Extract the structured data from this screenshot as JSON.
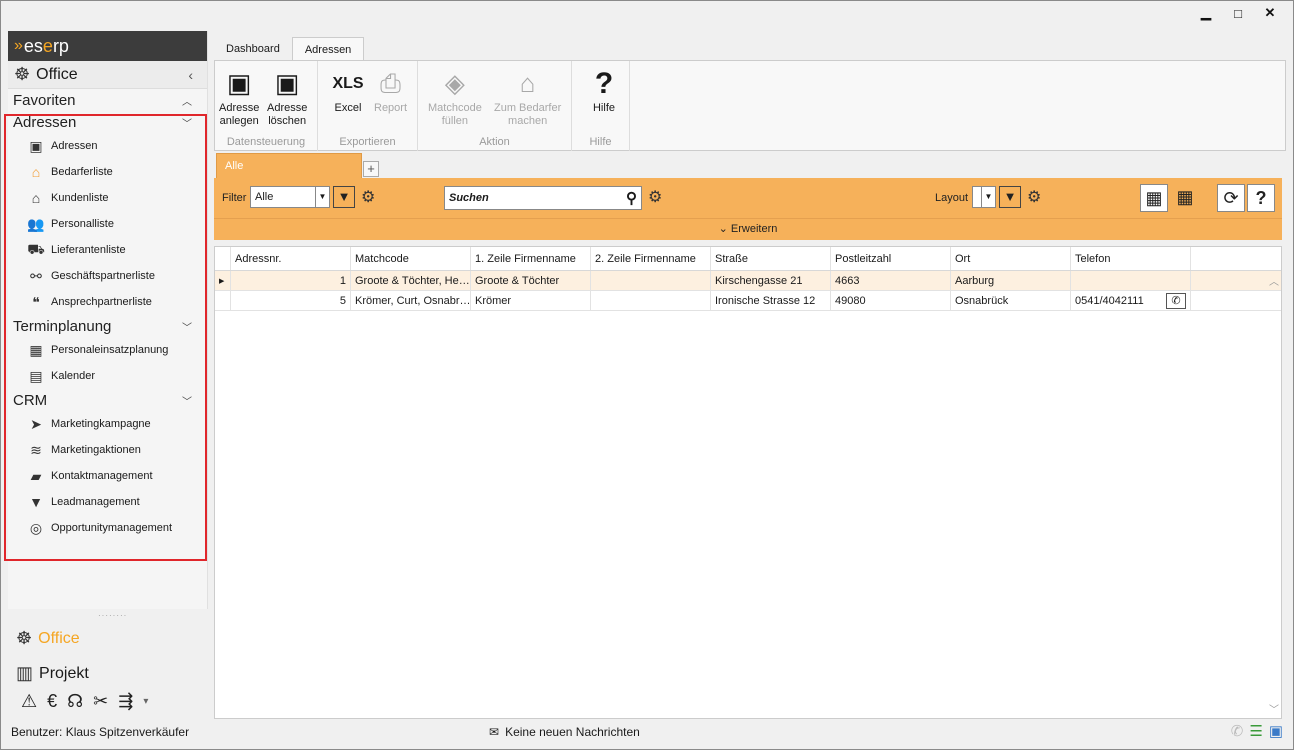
{
  "window": {
    "controls": [
      "▁",
      "□",
      "✕"
    ]
  },
  "logo": {
    "text_pre": "es",
    "text_mid": "e",
    "text_post": "rp"
  },
  "sidebar": {
    "header": "Office",
    "sections": [
      {
        "label": "Favoriten",
        "chevron": "^",
        "items": []
      },
      {
        "label": "Adressen",
        "chevron": "v",
        "items": [
          {
            "label": "Adressen",
            "icon": "address-book-icon"
          },
          {
            "label": "Bedarferliste",
            "icon": "house-icon"
          },
          {
            "label": "Kundenliste",
            "icon": "home-icon"
          },
          {
            "label": "Personalliste",
            "icon": "people-icon"
          },
          {
            "label": "Lieferantenliste",
            "icon": "truck-icon"
          },
          {
            "label": "Geschäftspartnerliste",
            "icon": "handshake-icon"
          },
          {
            "label": "Ansprechpartnerliste",
            "icon": "quote-icon"
          }
        ]
      },
      {
        "label": "Terminplanung",
        "chevron": "v",
        "items": [
          {
            "label": "Personaleinsatzplanung",
            "icon": "planning-icon"
          },
          {
            "label": "Kalender",
            "icon": "calendar-icon"
          }
        ]
      },
      {
        "label": "CRM",
        "chevron": "v",
        "items": [
          {
            "label": "Marketingkampagne",
            "icon": "paper-plane-icon"
          },
          {
            "label": "Marketingaktionen",
            "icon": "tornado-icon"
          },
          {
            "label": "Kontaktmanagement",
            "icon": "chat-icon"
          },
          {
            "label": "Leadmanagement",
            "icon": "funnel-icon"
          },
          {
            "label": "Opportunitymanagement",
            "icon": "target-icon"
          }
        ]
      }
    ],
    "bottom_nav": [
      {
        "label": "Office",
        "active": true
      },
      {
        "label": "Projekt",
        "active": false
      }
    ]
  },
  "ribbon": {
    "tabs": [
      "Dashboard",
      "Adressen"
    ],
    "groups": [
      {
        "label": "Datensteuerung",
        "buttons": [
          {
            "line1": "Adresse",
            "line2": "anlegen"
          },
          {
            "line1": "Adresse",
            "line2": "löschen"
          }
        ]
      },
      {
        "label": "Exportieren",
        "buttons": [
          {
            "line1": "Excel",
            "icon_text": "XLS"
          },
          {
            "line1": "Report"
          }
        ]
      },
      {
        "label": "Aktion",
        "buttons": [
          {
            "line1": "Matchcode",
            "line2": "füllen"
          },
          {
            "line1": "Zum Bedarfer",
            "line2": "machen"
          }
        ]
      },
      {
        "label": "Hilfe",
        "buttons": [
          {
            "line1": "Hilfe",
            "icon_text": "?"
          }
        ]
      }
    ]
  },
  "view": {
    "tab_label": "Alle",
    "filter_label": "Filter",
    "filter_value": "Alle",
    "search_placeholder": "Suchen",
    "layout_label": "Layout",
    "expand_label": "Erweitern"
  },
  "grid": {
    "columns": [
      "Adressnr.",
      "Matchcode",
      "1. Zeile Firmenname",
      "2. Zeile Firmenname",
      "Straße",
      "Postleitzahl",
      "Ort",
      "Telefon"
    ],
    "rows": [
      {
        "nr": "1",
        "matchcode": "Groote & Töchter, He…",
        "firma1": "Groote & Töchter",
        "firma2": "",
        "strasse": "Kirschengasse 21",
        "plz": "4663",
        "ort": "Aarburg",
        "telefon": ""
      },
      {
        "nr": "5",
        "matchcode": "Krömer, Curt, Osnabr…",
        "firma1": "Krömer",
        "firma2": "",
        "strasse": "Ironische Strasse 12",
        "plz": "49080",
        "ort": "Osnabrück",
        "telefon": "0541/4042111"
      }
    ]
  },
  "status": {
    "user": "Benutzer: Klaus Spitzenverkäufer",
    "messages": "Keine neuen Nachrichten"
  }
}
